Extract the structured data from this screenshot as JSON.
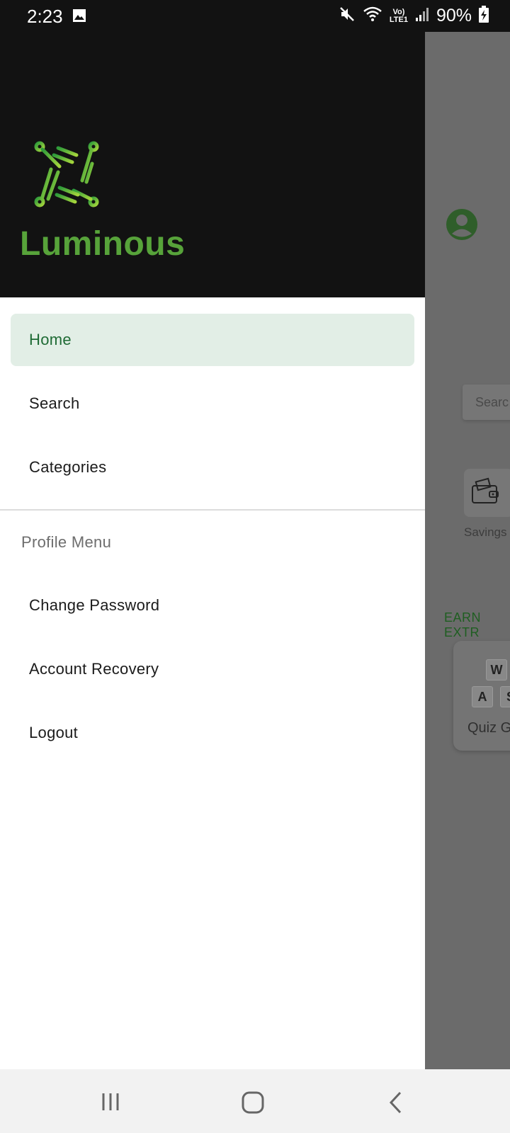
{
  "status_bar": {
    "time": "2:23",
    "battery": "90%",
    "network_top": "Vo)",
    "network_bottom": "LTE1"
  },
  "background_app": {
    "search_placeholder": "Searc",
    "savings_label": "Savings",
    "earn_label": "EARN EXTR",
    "quiz_label": "Quiz G",
    "keys": [
      "W",
      "A",
      "S"
    ]
  },
  "drawer": {
    "brand": "Luminous",
    "items": [
      {
        "label": "Home",
        "active": true
      },
      {
        "label": "Search",
        "active": false
      },
      {
        "label": "Categories",
        "active": false
      }
    ],
    "section_title": "Profile Menu",
    "profile_items": [
      {
        "label": "Change Password"
      },
      {
        "label": "Account Recovery"
      },
      {
        "label": "Logout"
      }
    ]
  },
  "colors": {
    "brand_green": "#57a33a",
    "active_bg": "#e2eee6",
    "active_text": "#1f6b35",
    "header_bg": "#121212"
  },
  "icons": {
    "status": [
      "gallery-icon",
      "mute-icon",
      "wifi-icon",
      "signal-icon",
      "battery-charging-icon"
    ],
    "nav": [
      "recent-apps-icon",
      "home-nav-icon",
      "back-icon"
    ]
  }
}
